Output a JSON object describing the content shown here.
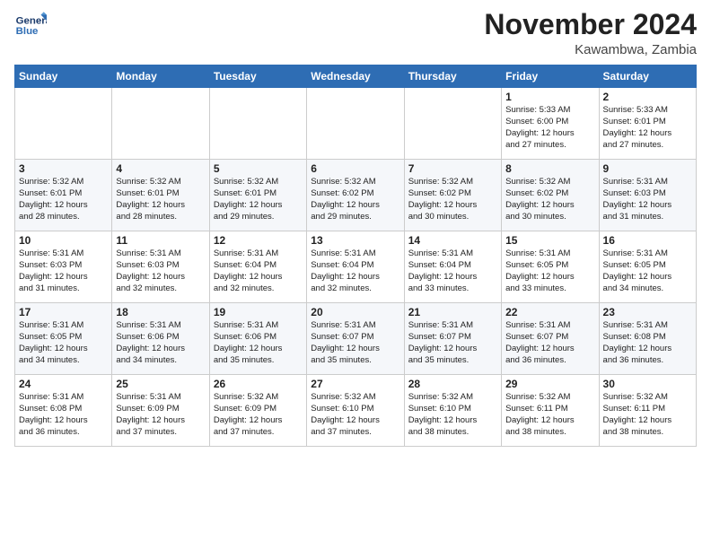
{
  "header": {
    "logo_line1": "General",
    "logo_line2": "Blue",
    "month": "November 2024",
    "location": "Kawambwa, Zambia"
  },
  "weekdays": [
    "Sunday",
    "Monday",
    "Tuesday",
    "Wednesday",
    "Thursday",
    "Friday",
    "Saturday"
  ],
  "weeks": [
    [
      {
        "day": "",
        "info": ""
      },
      {
        "day": "",
        "info": ""
      },
      {
        "day": "",
        "info": ""
      },
      {
        "day": "",
        "info": ""
      },
      {
        "day": "",
        "info": ""
      },
      {
        "day": "1",
        "info": "Sunrise: 5:33 AM\nSunset: 6:00 PM\nDaylight: 12 hours\nand 27 minutes."
      },
      {
        "day": "2",
        "info": "Sunrise: 5:33 AM\nSunset: 6:01 PM\nDaylight: 12 hours\nand 27 minutes."
      }
    ],
    [
      {
        "day": "3",
        "info": "Sunrise: 5:32 AM\nSunset: 6:01 PM\nDaylight: 12 hours\nand 28 minutes."
      },
      {
        "day": "4",
        "info": "Sunrise: 5:32 AM\nSunset: 6:01 PM\nDaylight: 12 hours\nand 28 minutes."
      },
      {
        "day": "5",
        "info": "Sunrise: 5:32 AM\nSunset: 6:01 PM\nDaylight: 12 hours\nand 29 minutes."
      },
      {
        "day": "6",
        "info": "Sunrise: 5:32 AM\nSunset: 6:02 PM\nDaylight: 12 hours\nand 29 minutes."
      },
      {
        "day": "7",
        "info": "Sunrise: 5:32 AM\nSunset: 6:02 PM\nDaylight: 12 hours\nand 30 minutes."
      },
      {
        "day": "8",
        "info": "Sunrise: 5:32 AM\nSunset: 6:02 PM\nDaylight: 12 hours\nand 30 minutes."
      },
      {
        "day": "9",
        "info": "Sunrise: 5:31 AM\nSunset: 6:03 PM\nDaylight: 12 hours\nand 31 minutes."
      }
    ],
    [
      {
        "day": "10",
        "info": "Sunrise: 5:31 AM\nSunset: 6:03 PM\nDaylight: 12 hours\nand 31 minutes."
      },
      {
        "day": "11",
        "info": "Sunrise: 5:31 AM\nSunset: 6:03 PM\nDaylight: 12 hours\nand 32 minutes."
      },
      {
        "day": "12",
        "info": "Sunrise: 5:31 AM\nSunset: 6:04 PM\nDaylight: 12 hours\nand 32 minutes."
      },
      {
        "day": "13",
        "info": "Sunrise: 5:31 AM\nSunset: 6:04 PM\nDaylight: 12 hours\nand 32 minutes."
      },
      {
        "day": "14",
        "info": "Sunrise: 5:31 AM\nSunset: 6:04 PM\nDaylight: 12 hours\nand 33 minutes."
      },
      {
        "day": "15",
        "info": "Sunrise: 5:31 AM\nSunset: 6:05 PM\nDaylight: 12 hours\nand 33 minutes."
      },
      {
        "day": "16",
        "info": "Sunrise: 5:31 AM\nSunset: 6:05 PM\nDaylight: 12 hours\nand 34 minutes."
      }
    ],
    [
      {
        "day": "17",
        "info": "Sunrise: 5:31 AM\nSunset: 6:05 PM\nDaylight: 12 hours\nand 34 minutes."
      },
      {
        "day": "18",
        "info": "Sunrise: 5:31 AM\nSunset: 6:06 PM\nDaylight: 12 hours\nand 34 minutes."
      },
      {
        "day": "19",
        "info": "Sunrise: 5:31 AM\nSunset: 6:06 PM\nDaylight: 12 hours\nand 35 minutes."
      },
      {
        "day": "20",
        "info": "Sunrise: 5:31 AM\nSunset: 6:07 PM\nDaylight: 12 hours\nand 35 minutes."
      },
      {
        "day": "21",
        "info": "Sunrise: 5:31 AM\nSunset: 6:07 PM\nDaylight: 12 hours\nand 35 minutes."
      },
      {
        "day": "22",
        "info": "Sunrise: 5:31 AM\nSunset: 6:07 PM\nDaylight: 12 hours\nand 36 minutes."
      },
      {
        "day": "23",
        "info": "Sunrise: 5:31 AM\nSunset: 6:08 PM\nDaylight: 12 hours\nand 36 minutes."
      }
    ],
    [
      {
        "day": "24",
        "info": "Sunrise: 5:31 AM\nSunset: 6:08 PM\nDaylight: 12 hours\nand 36 minutes."
      },
      {
        "day": "25",
        "info": "Sunrise: 5:31 AM\nSunset: 6:09 PM\nDaylight: 12 hours\nand 37 minutes."
      },
      {
        "day": "26",
        "info": "Sunrise: 5:32 AM\nSunset: 6:09 PM\nDaylight: 12 hours\nand 37 minutes."
      },
      {
        "day": "27",
        "info": "Sunrise: 5:32 AM\nSunset: 6:10 PM\nDaylight: 12 hours\nand 37 minutes."
      },
      {
        "day": "28",
        "info": "Sunrise: 5:32 AM\nSunset: 6:10 PM\nDaylight: 12 hours\nand 38 minutes."
      },
      {
        "day": "29",
        "info": "Sunrise: 5:32 AM\nSunset: 6:11 PM\nDaylight: 12 hours\nand 38 minutes."
      },
      {
        "day": "30",
        "info": "Sunrise: 5:32 AM\nSunset: 6:11 PM\nDaylight: 12 hours\nand 38 minutes."
      }
    ]
  ]
}
